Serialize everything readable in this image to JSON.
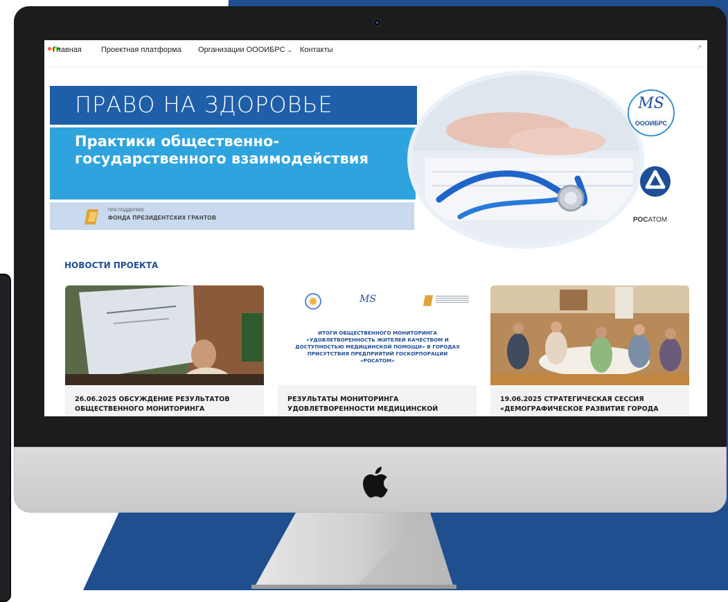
{
  "nav": {
    "items": [
      "Главная",
      "Проектная платформа",
      "Организации ОООИБРС",
      "Контакты"
    ],
    "chevron": "chevron-down-icon"
  },
  "banner": {
    "title": "ПРАВО НА ЗДОРОВЬЕ",
    "subtitle": "Практики общественно-государственного взаимодействия",
    "grant_small": "ПРИ ПОДДЕРЖКЕ",
    "grant_big": "ФОНДА ПРЕЗИДЕНТСКИХ ГРАНТОВ",
    "logo_ms": "MS",
    "logo_oooibrs": "ОООИБРС",
    "rosatom_prefix": "РОС",
    "rosatom_suffix": "АТОМ"
  },
  "news": {
    "heading": "НОВОСТИ ПРОЕКТА",
    "cards": [
      {
        "title": "26.06.2025 ОБСУЖДЕНИЕ РЕЗУЛЬТАТОВ ОБЩЕСТВЕННОГО МОНИТОРИНГА"
      },
      {
        "title": "РЕЗУЛЬТАТЫ МОНИТОРИНГА УДОВЛЕТВОРЕННОСТИ МЕДИЦИНСКОЙ",
        "poster": "ИТОГИ ОБЩЕСТВЕННОГО МОНИТОРИНГА «УДОВЛЕТВОРЕННОСТЬ ЖИТЕЛЕЙ КАЧЕСТВОМ И ДОСТУПНОСТЬЮ МЕДИЦИНСКОЙ ПОМОЩИ» В ГОРОДАХ ПРИСУТСТВИЯ ПРЕДПРИЯТИЙ ГОСКОРПОРАЦИИ «РОСАТОМ»"
      },
      {
        "title": "19.06.2025 СТРАТЕГИЧЕСКАЯ СЕССИЯ «ДЕМОГРАФИЧЕСКОЕ РАЗВИТИЕ ГОРОДА"
      }
    ]
  },
  "colors": {
    "backdrop_blue": "#1f4f8f",
    "title_band": "#1f5ea8",
    "subtitle_band": "#2fa3dd",
    "grant_band": "#c9d9ee",
    "news_heading": "#1f4e96"
  }
}
